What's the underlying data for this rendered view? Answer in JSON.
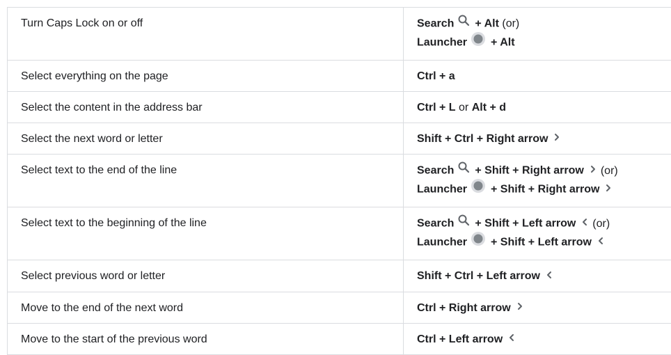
{
  "rows": [
    {
      "action": "Turn Caps Lock on or off",
      "lines": [
        [
          {
            "k": "Search"
          },
          {
            "icon": "search-icon"
          },
          {
            "k": "+ Alt"
          },
          {
            "s": "(or)"
          }
        ],
        [
          {
            "k": "Launcher"
          },
          {
            "icon": "launcher-icon"
          },
          {
            "k": "+ Alt"
          }
        ]
      ]
    },
    {
      "action": "Select everything on the page",
      "lines": [
        [
          {
            "k": "Ctrl + a"
          }
        ]
      ]
    },
    {
      "action": "Select the content in the address bar",
      "lines": [
        [
          {
            "k": "Ctrl + L"
          },
          {
            "s": "or"
          },
          {
            "k": "Alt + d"
          }
        ]
      ]
    },
    {
      "action": "Select the next word or letter",
      "lines": [
        [
          {
            "k": "Shift + Ctrl + Right arrow"
          },
          {
            "icon": "chevron-right-icon"
          }
        ]
      ]
    },
    {
      "action": "Select text to the end of the line",
      "lines": [
        [
          {
            "k": "Search"
          },
          {
            "icon": "search-icon"
          },
          {
            "k": "+ Shift + Right arrow"
          },
          {
            "icon": "chevron-right-icon"
          },
          {
            "s": "(or)"
          }
        ],
        [
          {
            "k": "Launcher"
          },
          {
            "icon": "launcher-icon"
          },
          {
            "k": "+ Shift + Right arrow"
          },
          {
            "icon": "chevron-right-icon"
          }
        ]
      ]
    },
    {
      "action": "Select text to the beginning of the line",
      "lines": [
        [
          {
            "k": "Search"
          },
          {
            "icon": "search-icon"
          },
          {
            "k": "+ Shift + Left arrow"
          },
          {
            "icon": "chevron-left-icon"
          },
          {
            "s": "(or)"
          }
        ],
        [
          {
            "k": "Launcher"
          },
          {
            "icon": "launcher-icon"
          },
          {
            "k": "+ Shift + Left arrow"
          },
          {
            "icon": "chevron-left-icon"
          }
        ]
      ]
    },
    {
      "action": "Select previous word or letter",
      "lines": [
        [
          {
            "k": "Shift + Ctrl + Left arrow"
          },
          {
            "icon": "chevron-left-icon"
          }
        ]
      ]
    },
    {
      "action": "Move to the end of the next word",
      "lines": [
        [
          {
            "k": "Ctrl + Right arrow"
          },
          {
            "icon": "chevron-right-icon"
          }
        ]
      ]
    },
    {
      "action": "Move to the start of the previous word",
      "lines": [
        [
          {
            "k": "Ctrl + Left arrow"
          },
          {
            "icon": "chevron-left-icon"
          }
        ]
      ]
    }
  ]
}
